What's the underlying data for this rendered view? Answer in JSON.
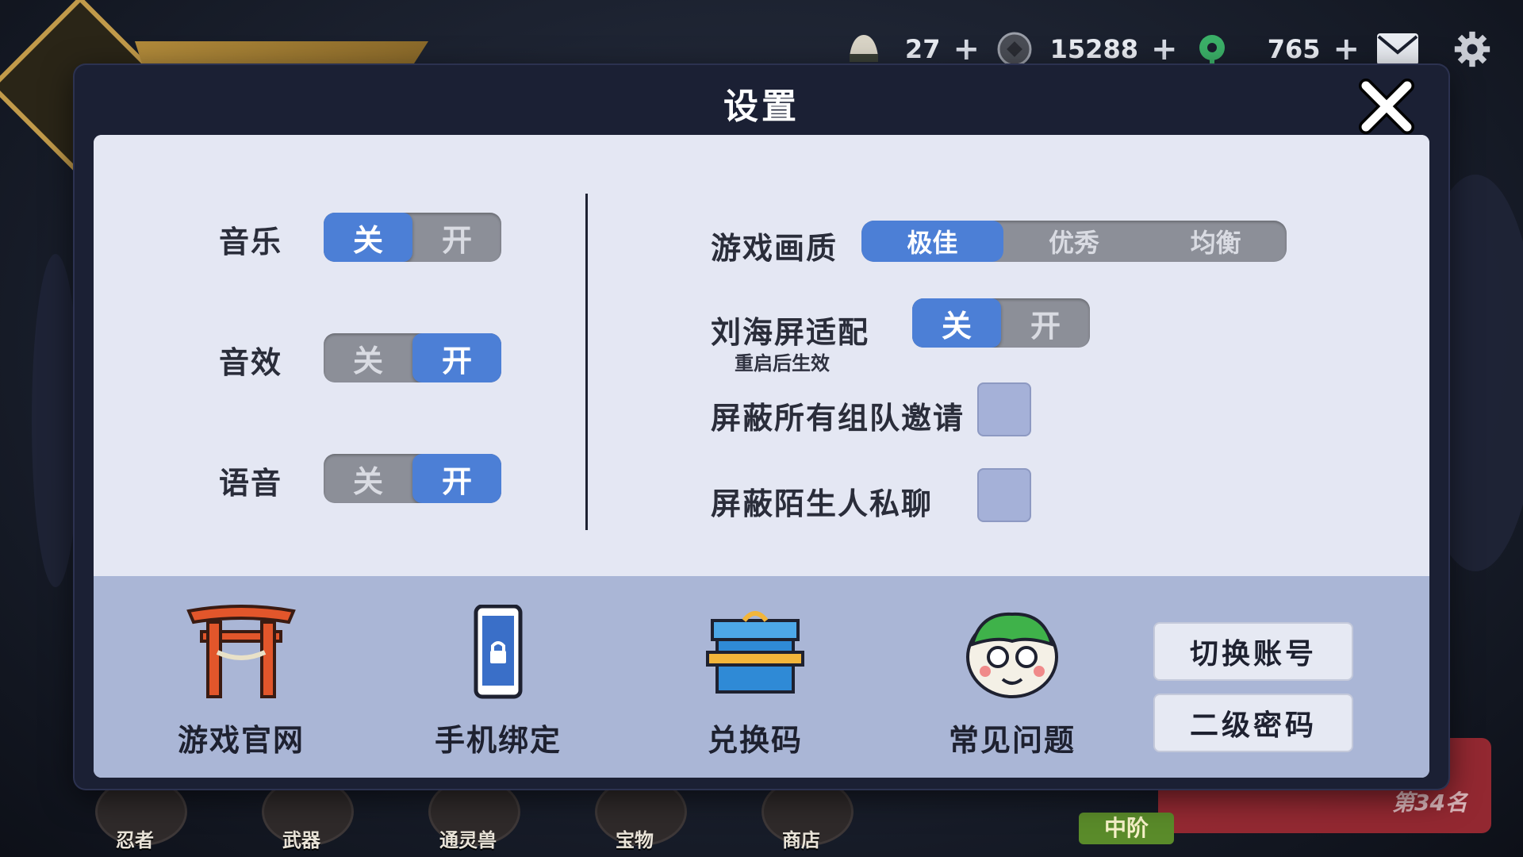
{
  "hud": {
    "rice": "27",
    "coins": "15288",
    "jade": "765",
    "plus": "+"
  },
  "bottom_nav": [
    {
      "label": "忍者"
    },
    {
      "label": "武器"
    },
    {
      "label": "通灵兽"
    },
    {
      "label": "宝物"
    },
    {
      "label": "商店"
    }
  ],
  "rank": "第34名",
  "badge": "中阶",
  "dialog": {
    "title": "设置",
    "left": {
      "music": {
        "label": "音乐",
        "off": "关",
        "on": "开",
        "value": "off"
      },
      "sfx": {
        "label": "音效",
        "off": "关",
        "on": "开",
        "value": "on"
      },
      "voice": {
        "label": "语音",
        "off": "关",
        "on": "开",
        "value": "on"
      }
    },
    "right": {
      "quality": {
        "label": "游戏画质",
        "options": [
          "极佳",
          "优秀",
          "均衡"
        ],
        "selected": "极佳"
      },
      "notch": {
        "label": "刘海屏适配",
        "note": "重启后生效",
        "off": "关",
        "on": "开",
        "value": "off"
      },
      "block_team": {
        "label": "屏蔽所有组队邀请",
        "checked": false
      },
      "block_pm": {
        "label": "屏蔽陌生人私聊",
        "checked": false
      }
    },
    "tiles": [
      {
        "label": "游戏官网",
        "icon": "torii-gate-icon"
      },
      {
        "label": "手机绑定",
        "icon": "phone-lock-icon"
      },
      {
        "label": "兑换码",
        "icon": "gift-box-icon"
      },
      {
        "label": "常见问题",
        "icon": "frog-helper-icon"
      }
    ],
    "buttons": {
      "switch_account": "切换账号",
      "second_password": "二级密码"
    }
  },
  "colors": {
    "accent": "#4c7fd6",
    "toggle_off": "#8c8f98",
    "panel": "#e4e7f3",
    "lower_panel": "#aab6d6",
    "dialog_frame": "#1b2034"
  }
}
